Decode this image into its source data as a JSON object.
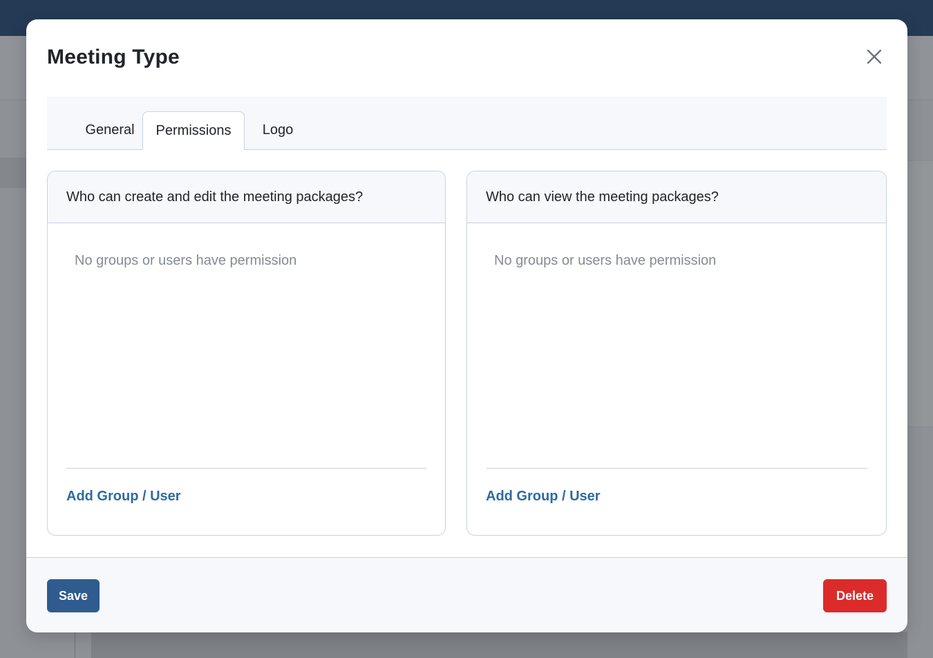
{
  "modal": {
    "title": "Meeting Type",
    "close_icon": "close-icon"
  },
  "tabs": [
    {
      "label": "General",
      "active": false
    },
    {
      "label": "Permissions",
      "active": true
    },
    {
      "label": "Logo",
      "active": false
    }
  ],
  "permissions": {
    "edit": {
      "heading": "Who can create and edit the meeting packages?",
      "empty_text": "No groups or users have permission",
      "add_link": "Add Group / User"
    },
    "view": {
      "heading": "Who can view the meeting packages?",
      "empty_text": "No groups or users have permission",
      "add_link": "Add Group / User"
    }
  },
  "footer": {
    "save_label": "Save",
    "delete_label": "Delete"
  },
  "colors": {
    "topbar": "#253a55",
    "primary": "#2f5b8f",
    "danger": "#dc2b2b",
    "link": "#2d6aa3"
  }
}
